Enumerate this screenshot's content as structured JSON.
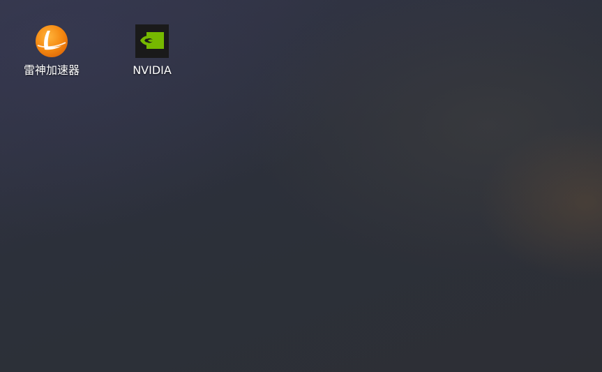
{
  "desktop": {
    "icons": [
      {
        "label": "雷神加速器",
        "icon": "leishen-accelerator-logo",
        "accent": "#f07a10"
      },
      {
        "label": "NVIDIA",
        "icon": "nvidia-logo",
        "accent": "#76b900"
      }
    ]
  }
}
